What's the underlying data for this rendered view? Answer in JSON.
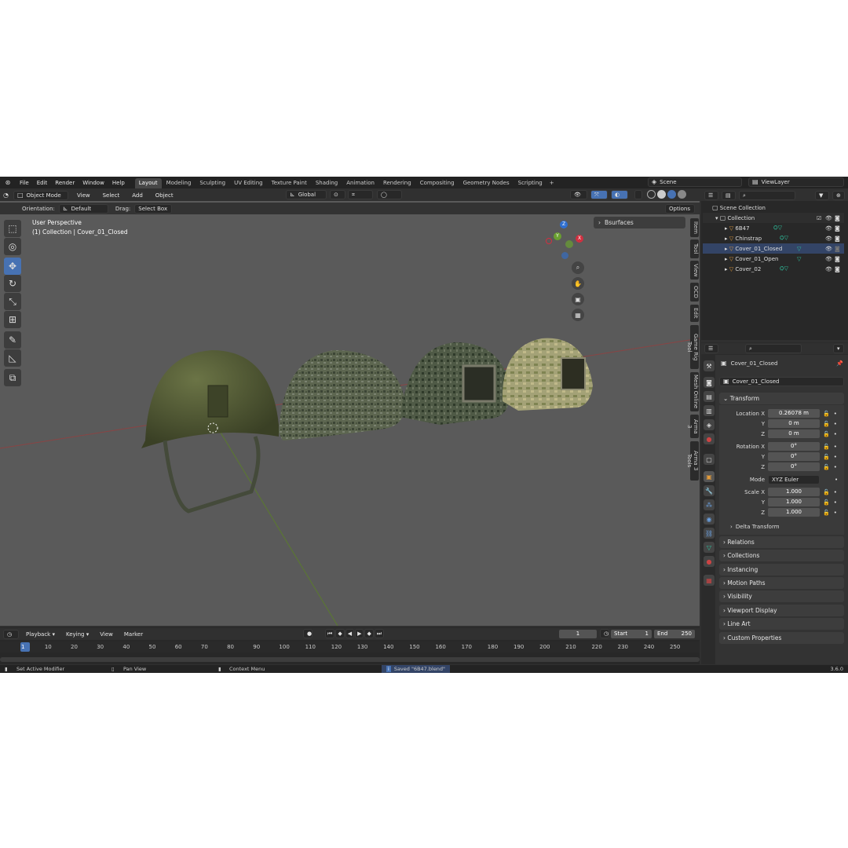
{
  "app": {
    "logo": "blender-logo-icon",
    "version": "3.6.0"
  },
  "menu": [
    "File",
    "Edit",
    "Render",
    "Window",
    "Help"
  ],
  "workspaces": [
    "Layout",
    "Modeling",
    "Sculpting",
    "UV Editing",
    "Texture Paint",
    "Shading",
    "Animation",
    "Rendering",
    "Compositing",
    "Geometry Nodes",
    "Scripting"
  ],
  "scene": {
    "name": "Scene",
    "view_layer": "ViewLayer"
  },
  "header": {
    "mode": "Object Mode",
    "view": "View",
    "select": "Select",
    "add": "Add",
    "object": "Object",
    "transform": "Global"
  },
  "toolsettings": {
    "orientation_label": "Orientation:",
    "orientation": "Default",
    "drag_label": "Drag:",
    "drag": "Select Box",
    "options": "Options"
  },
  "viewport": {
    "perspective": "User Perspective",
    "context": "(1) Collection | Cover_01_Closed",
    "bsurfaces": "Bsurfaces",
    "axis_x": "X",
    "axis_y": "Y",
    "axis_z": "Z"
  },
  "sidebar_tabs": [
    "Item",
    "Tool",
    "View",
    "OCD",
    "Edit",
    "Game Rig Tool",
    "Mesh Online",
    "Arma 3",
    "Arma 3 Tools"
  ],
  "outliner": {
    "root": "Scene Collection",
    "collection": "Collection",
    "items": [
      "6B47",
      "Chinstrap",
      "Cover_01_Closed",
      "Cover_01_Open",
      "Cover_02"
    ]
  },
  "properties": {
    "object_name": "Cover_01_Closed",
    "datablock": "Cover_01_Closed",
    "transform": "Transform",
    "location_label": "Location X",
    "loc": [
      "0.26078 m",
      "0 m",
      "0 m"
    ],
    "rotation_label": "Rotation X",
    "rot": [
      "0°",
      "0°",
      "0°"
    ],
    "mode_label": "Mode",
    "mode": "XYZ Euler",
    "scale_label": "Scale X",
    "scale": [
      "1.000",
      "1.000",
      "1.000"
    ],
    "y": "Y",
    "z": "Z",
    "delta": "Delta Transform",
    "panels": [
      "Relations",
      "Collections",
      "Instancing",
      "Motion Paths",
      "Visibility",
      "Viewport Display",
      "Line Art",
      "Custom Properties"
    ]
  },
  "timeline": {
    "playback": "Playback",
    "keying": "Keying",
    "view": "View",
    "marker": "Marker",
    "current": "1",
    "start_label": "Start",
    "start": "1",
    "end_label": "End",
    "end": "250",
    "ticks": [
      "1",
      "10",
      "20",
      "30",
      "40",
      "50",
      "60",
      "70",
      "80",
      "90",
      "100",
      "110",
      "120",
      "130",
      "140",
      "150",
      "160",
      "170",
      "180",
      "190",
      "200",
      "210",
      "220",
      "230",
      "240",
      "250"
    ]
  },
  "status": {
    "left": "Set Active Modifier",
    "mid": "Pan View",
    "ctx": "Context Menu",
    "saved": "Saved \"6B47.blend\""
  }
}
